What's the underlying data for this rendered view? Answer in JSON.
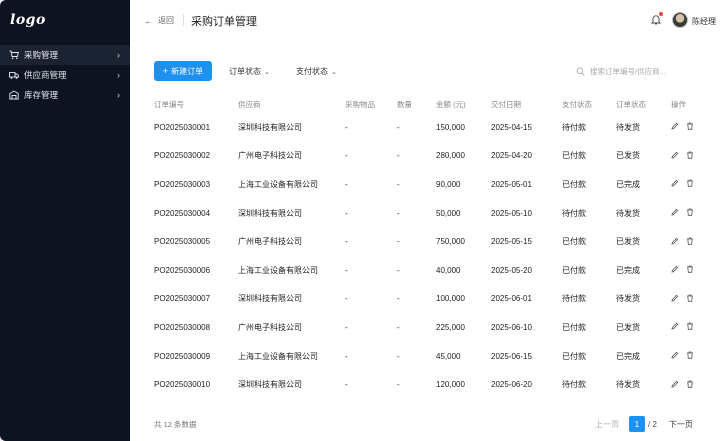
{
  "sidebar": {
    "logo": "logo",
    "items": [
      {
        "label": "采购管理",
        "icon": "cart-icon",
        "active": true
      },
      {
        "label": "供应商管理",
        "icon": "truck-icon",
        "active": false
      },
      {
        "label": "库存管理",
        "icon": "warehouse-icon",
        "active": false
      }
    ]
  },
  "header": {
    "back_label": "返回",
    "title": "采购订单管理",
    "user_name": "陈经理",
    "notification_dot": true
  },
  "toolbar": {
    "new_button": "新建订单",
    "filter_order_status": "订单状态",
    "filter_pay_status": "支付状态",
    "search_placeholder": "搜索订单编号/供应商..."
  },
  "table": {
    "columns": [
      "订单编号",
      "供应商",
      "采购物品",
      "数量",
      "金额 (元)",
      "交付日期",
      "支付状态",
      "订单状态",
      "操作"
    ],
    "rows": [
      {
        "id": "PO2025030001",
        "supplier": "深圳科技有限公司",
        "item": "-",
        "qty": "-",
        "amount": "150,000",
        "date": "2025-04-15",
        "pay": "待付款",
        "pay_type": "pending",
        "status": "待发货",
        "status_type": "pending"
      },
      {
        "id": "PO2025030002",
        "supplier": "广州电子科技公司",
        "item": "-",
        "qty": "-",
        "amount": "280,000",
        "date": "2025-04-20",
        "pay": "已付款",
        "pay_type": "done",
        "status": "已发货",
        "status_type": "shipped"
      },
      {
        "id": "PO2025030003",
        "supplier": "上海工业设备有限公司",
        "item": "-",
        "qty": "-",
        "amount": "90,000",
        "date": "2025-05-01",
        "pay": "已付款",
        "pay_type": "done",
        "status": "已完成",
        "status_type": "done"
      },
      {
        "id": "PO2025030004",
        "supplier": "深圳科技有限公司",
        "item": "-",
        "qty": "-",
        "amount": "50,000",
        "date": "2025-05-10",
        "pay": "待付款",
        "pay_type": "pending",
        "status": "待发货",
        "status_type": "pending"
      },
      {
        "id": "PO2025030005",
        "supplier": "广州电子科技公司",
        "item": "-",
        "qty": "-",
        "amount": "750,000",
        "date": "2025-05-15",
        "pay": "已付款",
        "pay_type": "done",
        "status": "已发货",
        "status_type": "shipped"
      },
      {
        "id": "PO2025030006",
        "supplier": "上海工业设备有限公司",
        "item": "-",
        "qty": "-",
        "amount": "40,000",
        "date": "2025-05-20",
        "pay": "已付款",
        "pay_type": "done",
        "status": "已完成",
        "status_type": "done"
      },
      {
        "id": "PO2025030007",
        "supplier": "深圳科技有限公司",
        "item": "-",
        "qty": "-",
        "amount": "100,000",
        "date": "2025-06-01",
        "pay": "待付款",
        "pay_type": "pending",
        "status": "待发货",
        "status_type": "pending"
      },
      {
        "id": "PO2025030008",
        "supplier": "广州电子科技公司",
        "item": "-",
        "qty": "-",
        "amount": "225,000",
        "date": "2025-06-10",
        "pay": "已付款",
        "pay_type": "done",
        "status": "已发货",
        "status_type": "shipped"
      },
      {
        "id": "PO2025030009",
        "supplier": "上海工业设备有限公司",
        "item": "-",
        "qty": "-",
        "amount": "45,000",
        "date": "2025-06-15",
        "pay": "已付款",
        "pay_type": "done",
        "status": "已完成",
        "status_type": "done"
      },
      {
        "id": "PO2025030010",
        "supplier": "深圳科技有限公司",
        "item": "-",
        "qty": "-",
        "amount": "120,000",
        "date": "2025-06-20",
        "pay": "待付款",
        "pay_type": "pending",
        "status": "待发货",
        "status_type": "pending"
      }
    ]
  },
  "footer": {
    "total_text": "共 12 条数据",
    "prev_label": "上一页",
    "current_page": "1",
    "total_pages": "/ 2",
    "next_label": "下一页"
  },
  "colors": {
    "sidebar_bg": "#0d1320",
    "primary": "#1e90f0",
    "pending": "#e1a000",
    "done": "#22b24c",
    "shipped": "#2a7fe0"
  }
}
